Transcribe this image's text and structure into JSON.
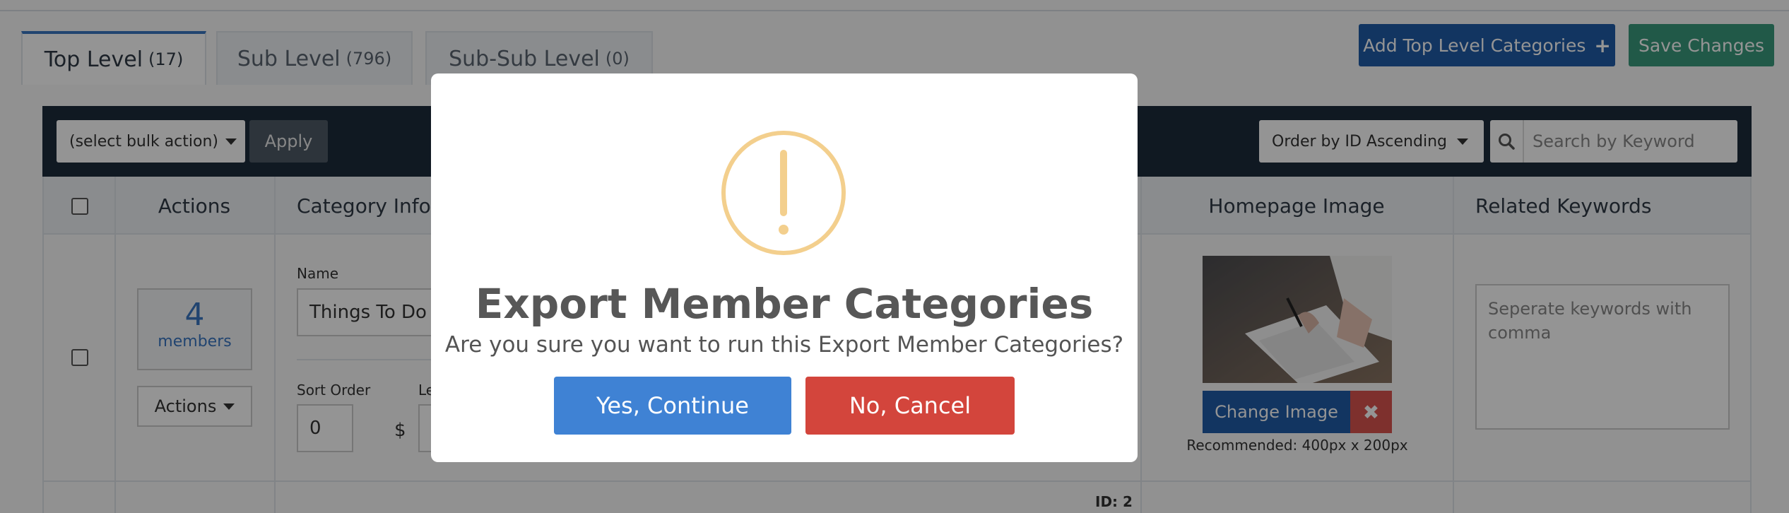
{
  "tabs": [
    {
      "label": "Top Level",
      "count": "(17)"
    },
    {
      "label": "Sub Level",
      "count": "(796)"
    },
    {
      "label": "Sub-Sub Level",
      "count": "(0)"
    }
  ],
  "header_buttons": {
    "add_label": "Add Top Level Categories",
    "add_icon": "plus-icon",
    "save_label": "Save Changes"
  },
  "toolbar": {
    "bulk_action": "(select bulk action)",
    "apply_label": "Apply",
    "order_by": "Order by ID Ascending",
    "search_placeholder": "Search by Keyword"
  },
  "table": {
    "headers": {
      "actions": "Actions",
      "category_info": "Category Info",
      "homepage_image": "Homepage Image",
      "related_keywords": "Related Keywords"
    },
    "row": {
      "members_count": "4",
      "members_label": "members",
      "actions_label": "Actions",
      "name_label": "Name",
      "name_value": "Things To Do",
      "sort_order_label": "Sort Order",
      "sort_order_value": "0",
      "partial_label": "Le",
      "currency_symbol": "$",
      "change_image_label": "Change Image",
      "remove_icon": "✖",
      "recommended": "Recommended: 400px x 200px",
      "keywords_placeholder": "Seperate keywords with comma"
    },
    "next_row_id": "ID: 2"
  },
  "modal": {
    "title": "Export Member Categories",
    "message": "Are you sure you want to run this Export Member Categories?",
    "confirm_label": "Yes, Continue",
    "cancel_label": "No, Cancel",
    "icon": "warning-icon",
    "icon_color": "#f3cf8d",
    "confirm_color": "#3f82d4",
    "cancel_color": "#d3453c"
  }
}
